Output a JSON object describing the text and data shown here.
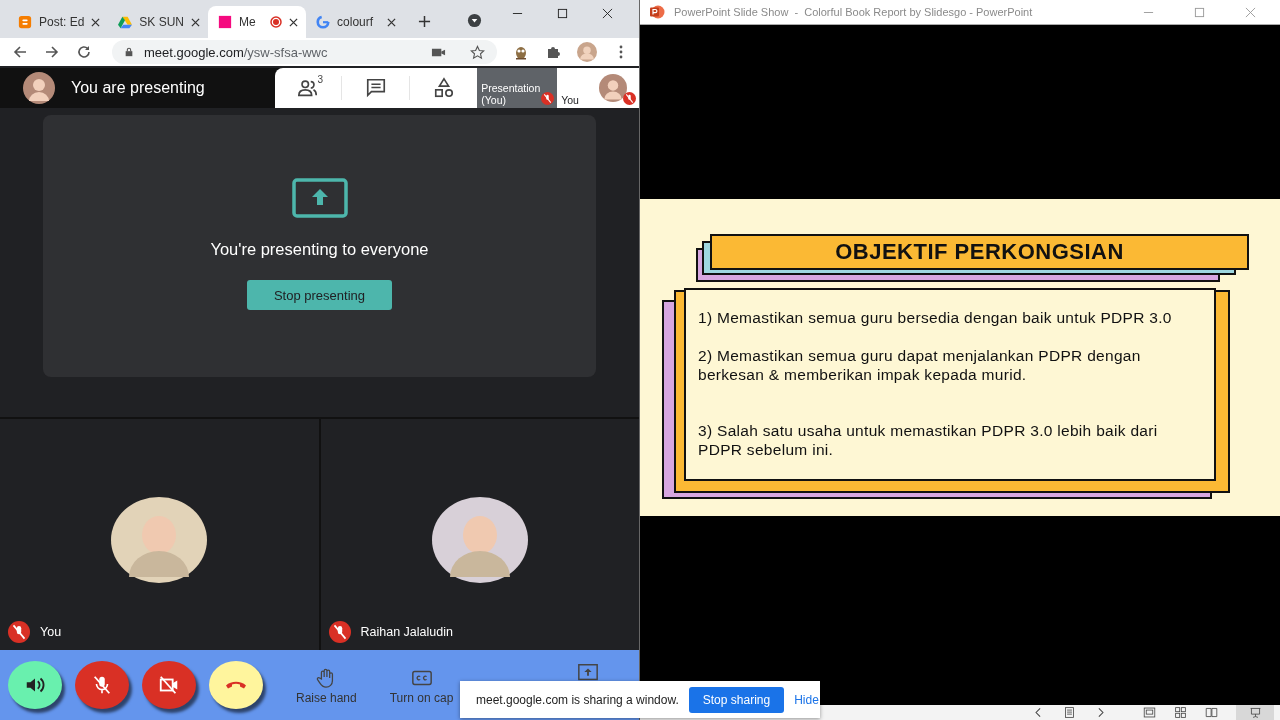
{
  "browser": {
    "tabs": [
      {
        "title": "Post: Ed",
        "kind": "blogger",
        "selected": false,
        "recording": false
      },
      {
        "title": "SK SUN",
        "kind": "drive",
        "selected": false,
        "recording": false
      },
      {
        "title": "Me",
        "kind": "meet",
        "selected": true,
        "recording": true
      },
      {
        "title": "colourf",
        "kind": "google",
        "selected": false,
        "recording": false
      }
    ],
    "address": {
      "host": "meet.google.com",
      "path": "/ysw-sfsa-wwc"
    }
  },
  "meet": {
    "header": "You are presenting",
    "people_count": "3",
    "top_tiles": [
      {
        "label": "Presentation (You)",
        "kind": "presentation",
        "muted": true
      },
      {
        "label": "You",
        "kind": "camera",
        "muted": true
      }
    ],
    "message": "You're presenting to everyone",
    "stop_button": "Stop presenting",
    "participants": [
      {
        "name": "You",
        "muted": true
      },
      {
        "name": "Raihan Jalaludin",
        "muted": true
      }
    ],
    "round_controls": [
      {
        "kind": "speaker",
        "color": "#69f0ae"
      },
      {
        "kind": "mic-off",
        "color": "#d93025"
      },
      {
        "kind": "camera-off",
        "color": "#d93025"
      },
      {
        "kind": "hang-up",
        "color": "#fff59d"
      }
    ],
    "labeled_controls": [
      {
        "kind": "hand",
        "label": "Raise hand"
      },
      {
        "kind": "captions",
        "label": "Turn on cap"
      }
    ]
  },
  "share_bar": {
    "message": "meet.google.com is sharing a window.",
    "stop": "Stop sharing",
    "hide": "Hide"
  },
  "powerpoint": {
    "title": "PowerPoint Slide Show  -  Colorful Book Report by Slidesgo - PowerPoint",
    "slide": {
      "title": "OBJEKTIF PERKONGSIAN",
      "points": [
        "1) Memastikan semua guru bersedia dengan baik untuk PDPR 3.0",
        "2) Memastikan semua guru dapat menjalankan PDPR dengan berkesan & memberikan impak kepada murid.",
        "3) Salah satu usaha untuk memastikan PDPR 3.0 lebih baik dari PDPR sebelum ini."
      ]
    }
  }
}
